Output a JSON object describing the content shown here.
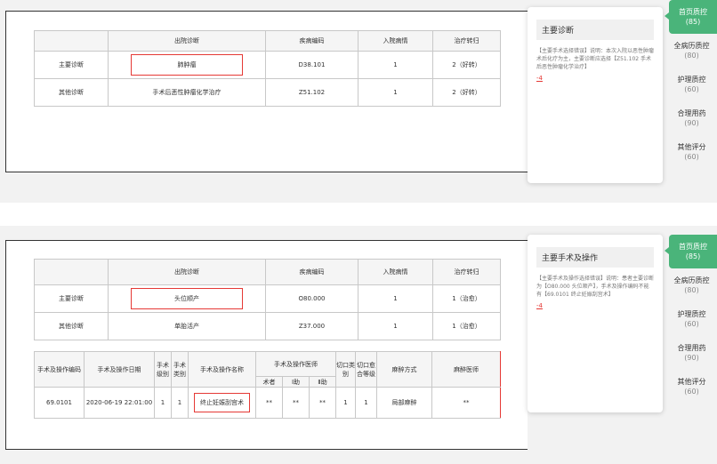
{
  "diag_headers": {
    "blank": "",
    "diagnosis": "出院诊断",
    "code": "疾病编码",
    "admission": "入院病情",
    "outcome": "治疗转归"
  },
  "panel1": {
    "rows": [
      {
        "type": "主要诊断",
        "diagnosis": "肺肿瘤",
        "code": "D38.101",
        "admission": "1",
        "outcome": "2（好转）"
      },
      {
        "type": "其他诊断",
        "diagnosis": "手术后恶性肿瘤化学治疗",
        "code": "Z51.102",
        "admission": "1",
        "outcome": "2（好转）"
      }
    ],
    "card": {
      "title": "主要诊断",
      "text": "【主要手术选择错误】说明：本次入院以恶性肿瘤术后化疗为主，主要诊断应选择【Z51.102 手术后恶性肿瘤化学治疗】",
      "delta": "-4"
    }
  },
  "panel2": {
    "rows": [
      {
        "type": "主要诊断",
        "diagnosis": "头位顺产",
        "code": "O80.000",
        "admission": "1",
        "outcome": "1（治愈）"
      },
      {
        "type": "其他诊断",
        "diagnosis": "单胎活产",
        "code": "Z37.000",
        "admission": "1",
        "outcome": "1（治愈）"
      }
    ],
    "op_headers": {
      "code": "手术及操作编码",
      "date": "手术及操作日期",
      "level": "手术级别",
      "cls": "手术类别",
      "name": "手术及操作名称",
      "doctors": "手术及操作医师",
      "surgeon": "术者",
      "a1": "Ⅰ助",
      "a2": "Ⅱ助",
      "incision": "切口类别",
      "healing": "切口愈合等级",
      "anes": "麻醉方式",
      "anes_doc": "麻醉医师"
    },
    "op_row": {
      "code": "69.0101",
      "date": "2020-06-19 22:01:00",
      "level": "1",
      "cls": "1",
      "name": "终止妊娠刮宫术",
      "surgeon": "**",
      "a1": "**",
      "a2": "**",
      "incision": "1",
      "healing": "1",
      "anes": "局部麻醉",
      "anes_doc": "**"
    },
    "card": {
      "title": "主要手术及操作",
      "text": "【主要手术及操作选择错误】说明：患者主要诊断为【O80.000 头位顺产】，手术及操作编码不能有【69.0101 终止妊娠刮宫术】",
      "delta": "-4"
    }
  },
  "tabs": [
    {
      "label": "首页质控",
      "score": "(85)"
    },
    {
      "label": "全病历质控",
      "score": "(80)"
    },
    {
      "label": "护理质控",
      "score": "(60)"
    },
    {
      "label": "合理用药",
      "score": "(90)"
    },
    {
      "label": "其他评分",
      "score": "(60)"
    }
  ]
}
